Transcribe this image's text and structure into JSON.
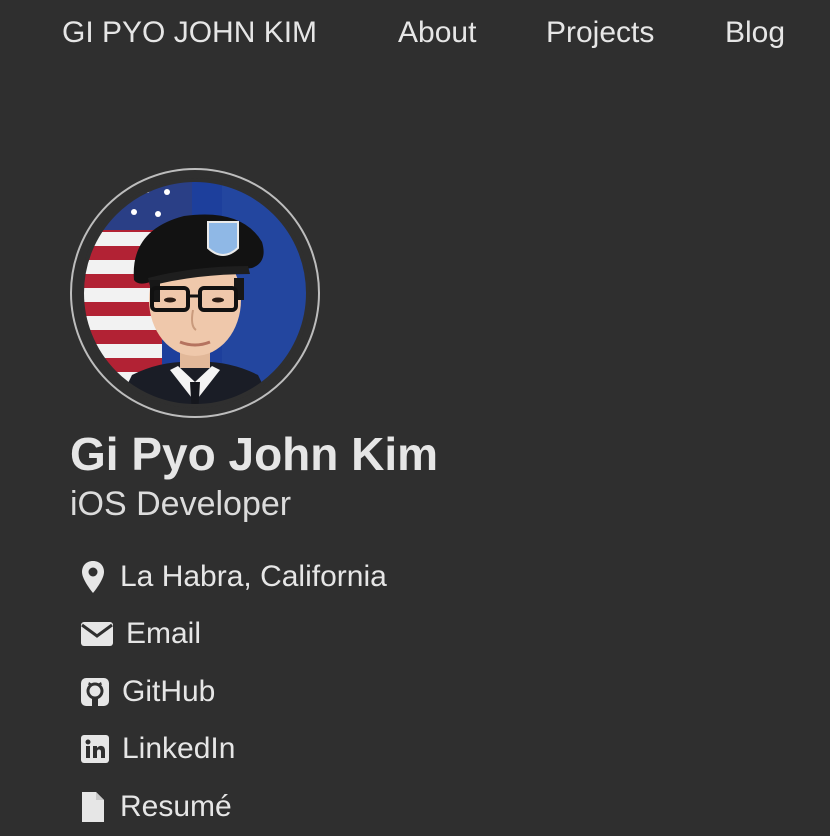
{
  "nav": {
    "brand": "GI PYO JOHN KIM",
    "items": [
      {
        "label": "About"
      },
      {
        "label": "Projects"
      },
      {
        "label": "Blog"
      }
    ]
  },
  "profile": {
    "name": "Gi Pyo John Kim",
    "title": "iOS Developer",
    "avatar_icon": "profile-photo"
  },
  "links": [
    {
      "icon": "map-marker-icon",
      "label": "La Habra, California"
    },
    {
      "icon": "envelope-icon",
      "label": "Email"
    },
    {
      "icon": "github-icon",
      "label": "GitHub"
    },
    {
      "icon": "linkedin-icon",
      "label": "LinkedIn"
    },
    {
      "icon": "file-icon",
      "label": "Resumé"
    }
  ],
  "colors": {
    "background": "#2f2f2f",
    "text": "#e6e6e6",
    "avatar_border": "#bdbdbd"
  }
}
